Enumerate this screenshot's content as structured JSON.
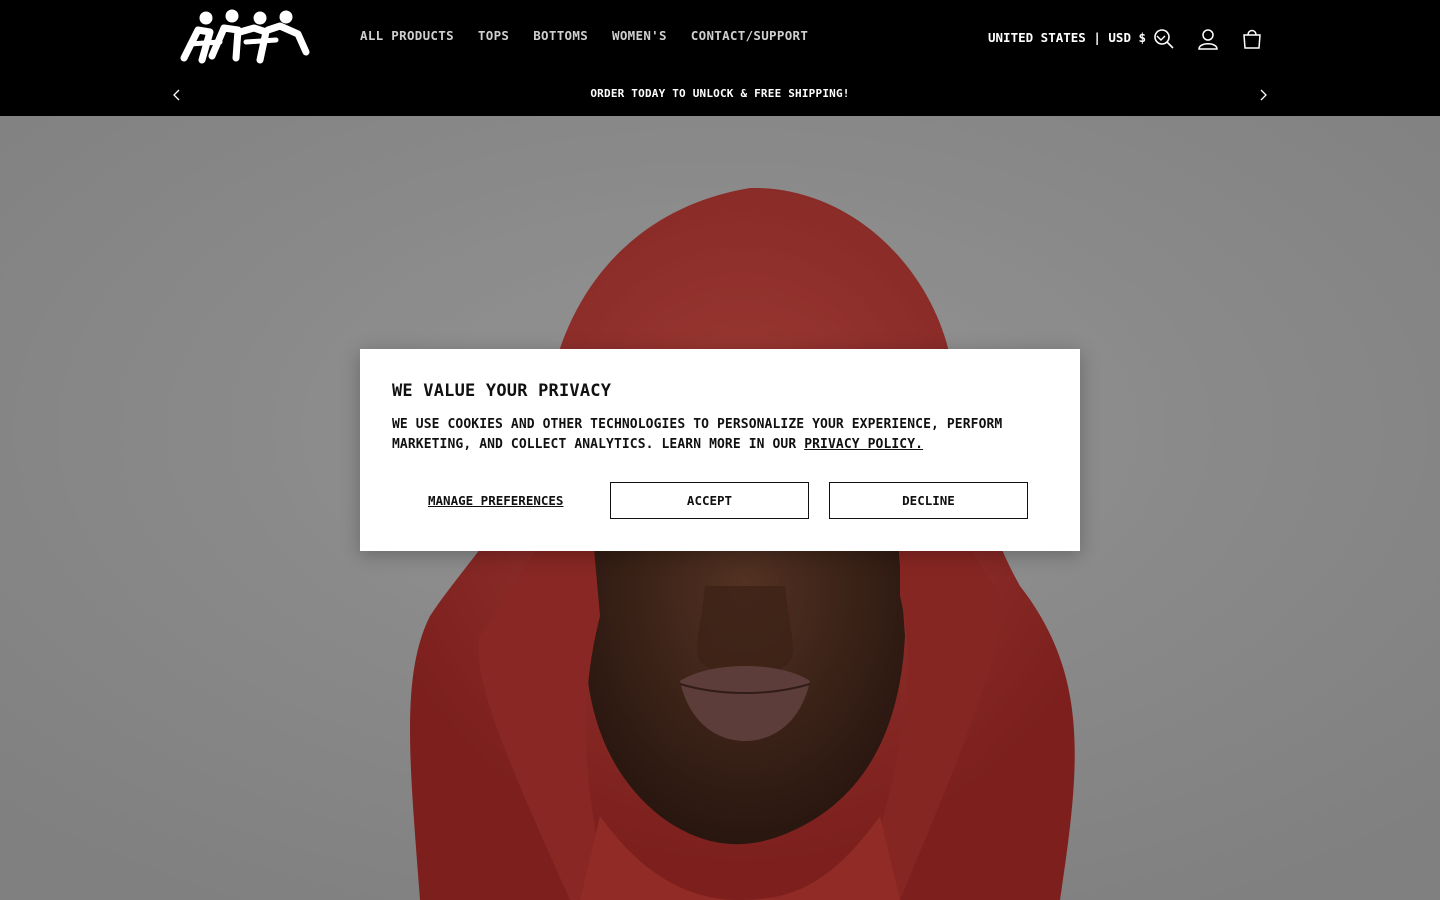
{
  "header": {
    "logo_alt": "site-logo",
    "nav": [
      {
        "label": "ALL PRODUCTS"
      },
      {
        "label": "TOPS"
      },
      {
        "label": "BOTTOMS"
      },
      {
        "label": "WOMEN'S"
      },
      {
        "label": "CONTACT/SUPPORT"
      }
    ],
    "country_selector": "UNITED STATES | USD $",
    "icons": [
      "search-icon",
      "account-icon",
      "cart-icon"
    ]
  },
  "announcement": {
    "text": "ORDER TODAY TO UNLOCK & FREE SHIPPING!"
  },
  "hero": {
    "image_subject": "person-in-red-hoodie"
  },
  "cookie_modal": {
    "title": "WE VALUE YOUR PRIVACY",
    "body": "WE USE COOKIES AND OTHER TECHNOLOGIES TO PERSONALIZE YOUR EXPERIENCE, PERFORM MARKETING, AND COLLECT ANALYTICS. LEARN MORE IN OUR ",
    "link": "PRIVACY POLICY.",
    "manage_label": "MANAGE PREFERENCES",
    "accept_label": "ACCEPT",
    "decline_label": "DECLINE"
  },
  "colors": {
    "header_bg": "#000000",
    "modal_bg": "#ffffff",
    "hoodie_red": "#d73a3a"
  }
}
